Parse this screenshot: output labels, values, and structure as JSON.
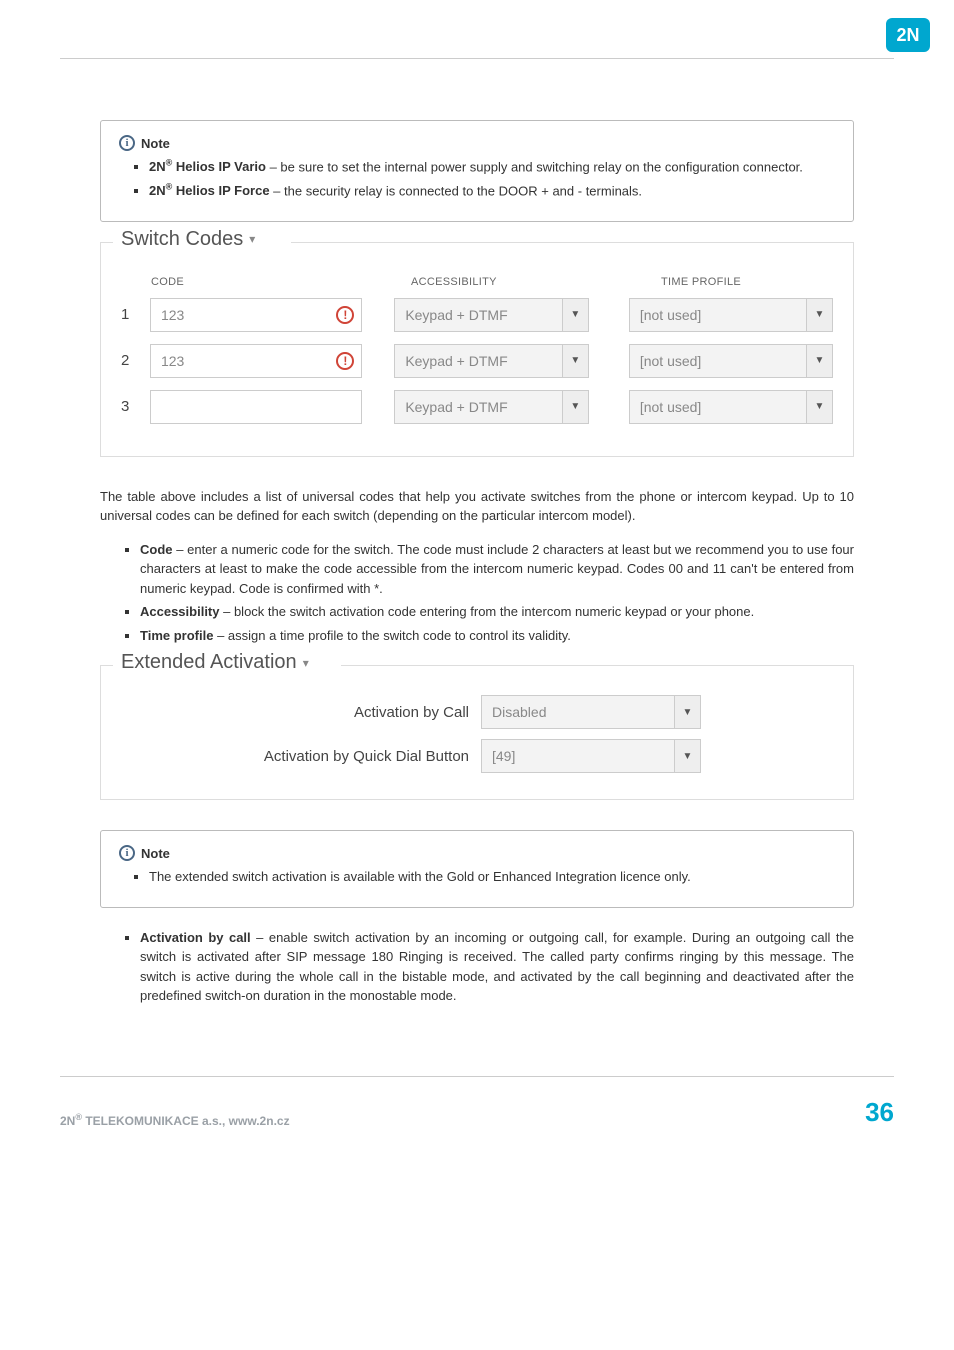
{
  "note1": {
    "title": "Note",
    "items": [
      {
        "bold": "2N® Helios IP Vario",
        "rest": " – be sure to set the internal power supply and switching relay on the configuration connector."
      },
      {
        "bold": "2N® Helios IP Force",
        "rest": " – the security relay is connected to the DOOR + and - terminals."
      }
    ]
  },
  "switch_codes": {
    "title": "Switch Codes",
    "headers": {
      "code": "CODE",
      "acc": "ACCESSIBILITY",
      "tp": "TIME PROFILE"
    },
    "rows": [
      {
        "idx": "1",
        "code": "123",
        "warn": true,
        "acc": "Keypad + DTMF",
        "tp": "[not used]"
      },
      {
        "idx": "2",
        "code": "123",
        "warn": true,
        "acc": "Keypad + DTMF",
        "tp": "[not used]"
      },
      {
        "idx": "3",
        "code": "",
        "warn": false,
        "acc": "Keypad + DTMF",
        "tp": "[not used]"
      }
    ]
  },
  "para1": "The table above includes a list of universal codes that help you activate switches from the phone or intercom keypad. Up to 10 universal codes can be defined for each switch (depending on the particular intercom model).",
  "bullets": [
    {
      "bold": "Code",
      "rest": " – enter a numeric code for the switch. The code must include 2 characters at least but we recommend you to use four characters at least to make the code accessible from the intercom numeric keypad. Codes 00 and 11 can't be entered from numeric keypad. Code is confirmed with *."
    },
    {
      "bold": "Accessibility",
      "rest": " – block the switch activation code entering from the intercom numeric keypad or your phone."
    },
    {
      "bold": "Time profile",
      "rest": " – assign a time profile to the switch code to control its validity."
    }
  ],
  "ext": {
    "title": "Extended Activation",
    "rows": [
      {
        "label": "Activation by Call",
        "value": "Disabled"
      },
      {
        "label": "Activation by Quick Dial Button",
        "value": "[49]"
      }
    ]
  },
  "note2": {
    "title": "Note",
    "text": "The extended switch activation is available with the Gold or Enhanced Integration licence only."
  },
  "bullet2": {
    "bold": "Activation by call",
    "rest": " – enable switch activation by an incoming or outgoing call, for example. During an outgoing call the switch is activated after SIP message 180 Ringing is received. The called party confirms ringing by this message. The switch is active during the whole call in the bistable mode, and activated by the call beginning and deactivated after the predefined switch-on duration in the monostable mode."
  },
  "footer": {
    "left": "2N® TELEKOMUNIKACE a.s., www.2n.cz",
    "page": "36"
  }
}
